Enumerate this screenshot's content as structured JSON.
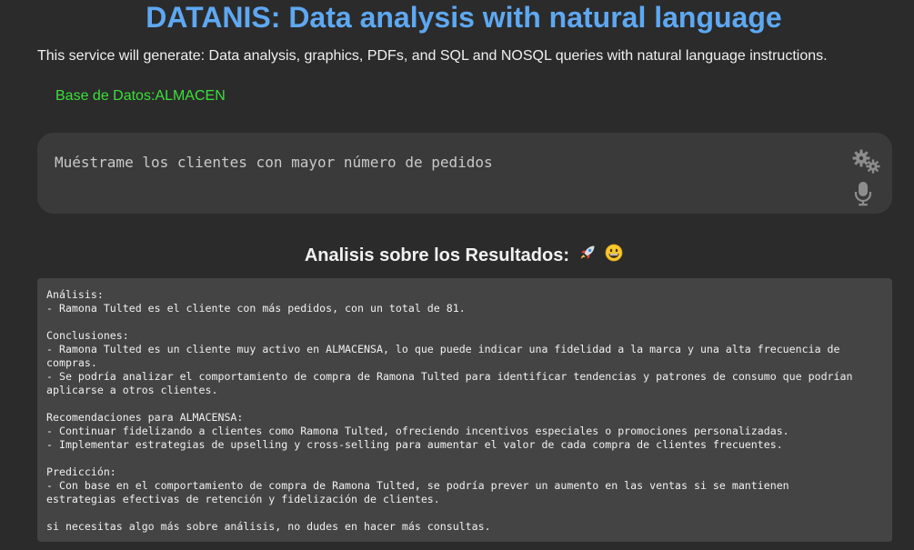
{
  "header": {
    "title": "DATANIS: Data analysis with natural language",
    "subtitle": "This service will generate: Data analysis, graphics, PDFs, and SQL and NOSQL queries with natural language instructions."
  },
  "database": {
    "label": "Base de Datos:ALMACEN"
  },
  "query": {
    "value": "Muéstrame los clientes con mayor número de pedidos"
  },
  "results": {
    "heading": "Analisis sobre los Resultados:",
    "heading_emojis": [
      "rocket-icon",
      "grinning-face-icon"
    ],
    "lines": [
      "Análisis:",
      "- Ramona Tulted es el cliente con más pedidos, con un total de 81.",
      "",
      "Conclusiones:",
      "- Ramona Tulted es un cliente muy activo en ALMACENSA, lo que puede indicar una fidelidad a la marca y una alta frecuencia de",
      "compras.",
      "- Se podría analizar el comportamiento de compra de Ramona Tulted para identificar tendencias y patrones de consumo que podrían",
      "aplicarse a otros clientes.",
      "",
      "Recomendaciones para ALMACENSA:",
      "- Continuar fidelizando a clientes como Ramona Tulted, ofreciendo incentivos especiales o promociones personalizadas.",
      "- Implementar estrategias de upselling y cross-selling para aumentar el valor de cada compra de clientes frecuentes.",
      "",
      "Predicción:",
      "- Con base en el comportamiento de compra de Ramona Tulted, se podría prever un aumento en las ventas si se mantienen",
      "estrategias efectivas de retención y fidelización de clientes.",
      "",
      "si necesitas algo más sobre análisis, no dudes en hacer más consultas."
    ]
  },
  "colors": {
    "background": "#2b2b2b",
    "title": "#5ea8f2",
    "database_label": "#3ae03a",
    "query_box": "#3a3a3a",
    "results_box": "#444444"
  }
}
